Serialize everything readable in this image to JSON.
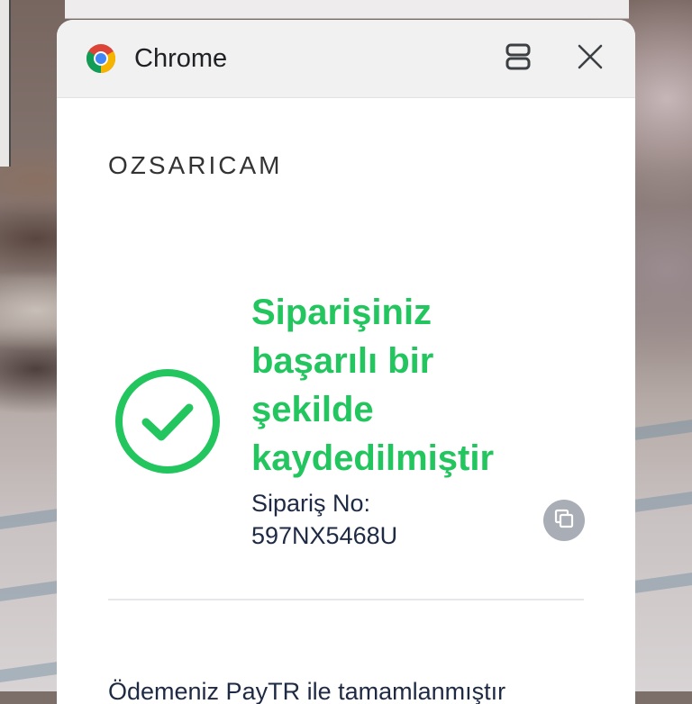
{
  "browser": {
    "title": "Chrome",
    "icons": {
      "logo": "chrome-logo-icon",
      "layout": "side-panel-icon",
      "close": "close-icon"
    }
  },
  "page": {
    "logo": "OZSARICAM",
    "success_heading": "Siparişiniz başarılı bir şekilde kaydedilmiştir",
    "order_label": "Sipariş No:",
    "order_number": "597NX5468U",
    "payment_text": "Ödemeniz PayTR ile tamamlanmıştır",
    "icons": {
      "success": "check-circle-icon",
      "copy": "copy-icon"
    }
  },
  "colors": {
    "success_green": "#22c55e",
    "text_dark": "#1e2a44",
    "toolbar_bg": "#f1f1f1",
    "copy_button_bg": "#a9adb6"
  }
}
